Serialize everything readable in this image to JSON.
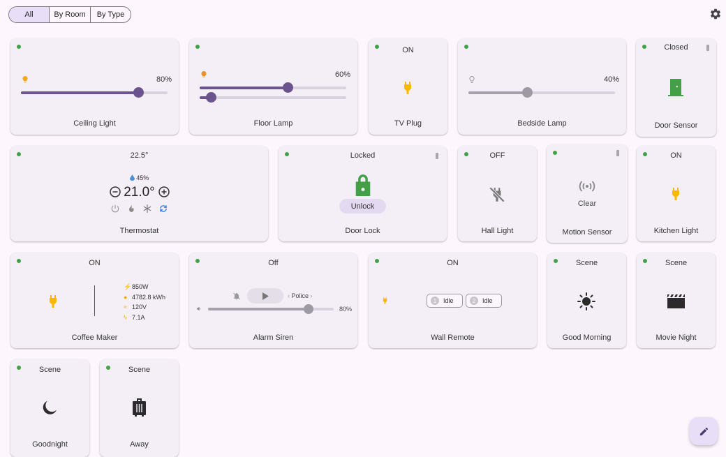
{
  "filter": {
    "options": [
      "All",
      "By Room",
      "By Type"
    ],
    "selected": "All"
  },
  "cards": {
    "ceiling_light": {
      "name": "Ceiling Light",
      "pct_label": "80%",
      "level": 0.8
    },
    "floor_lamp": {
      "name": "Floor Lamp",
      "pct_label": "60%",
      "level": 0.6,
      "level2": 0.08
    },
    "tv_plug": {
      "name": "TV Plug",
      "status": "ON"
    },
    "bedside_lamp": {
      "name": "Bedside Lamp",
      "pct_label": "40%",
      "level": 0.4
    },
    "door_sensor": {
      "name": "Door Sensor",
      "status": "Closed"
    },
    "thermostat": {
      "name": "Thermostat",
      "current": "22.5°",
      "humidity": "45%",
      "target": "21.0°"
    },
    "door_lock": {
      "name": "Door Lock",
      "status": "Locked",
      "button": "Unlock"
    },
    "hall_light": {
      "name": "Hall Light",
      "status": "OFF"
    },
    "motion_sensor": {
      "name": "Motion Sensor",
      "status": "Clear"
    },
    "kitchen_light": {
      "name": "Kitchen Light",
      "status": "ON"
    },
    "coffee_maker": {
      "name": "Coffee Maker",
      "status": "ON",
      "power": "850W",
      "energy": "4782.8 kWh",
      "voltage": "120V",
      "current": "7.1A"
    },
    "alarm_siren": {
      "name": "Alarm Siren",
      "status": "Off",
      "tone": "Police",
      "volume_label": "80%",
      "volume": 0.8
    },
    "wall_remote": {
      "name": "Wall Remote",
      "status": "ON",
      "buttons": [
        {
          "num": "1",
          "state": "Idle"
        },
        {
          "num": "2",
          "state": "Idle"
        }
      ]
    },
    "good_morning": {
      "name": "Good Morning",
      "status": "Scene"
    },
    "movie_night": {
      "name": "Movie Night",
      "status": "Scene"
    },
    "goodnight": {
      "name": "Goodnight",
      "status": "Scene"
    },
    "away": {
      "name": "Away",
      "status": "Scene"
    }
  },
  "colors": {
    "accent": "#6b548e",
    "online": "#43a047",
    "plug_on": "#f9b800",
    "lock": "#43a047",
    "scene_icon": "#2b2b2b"
  }
}
